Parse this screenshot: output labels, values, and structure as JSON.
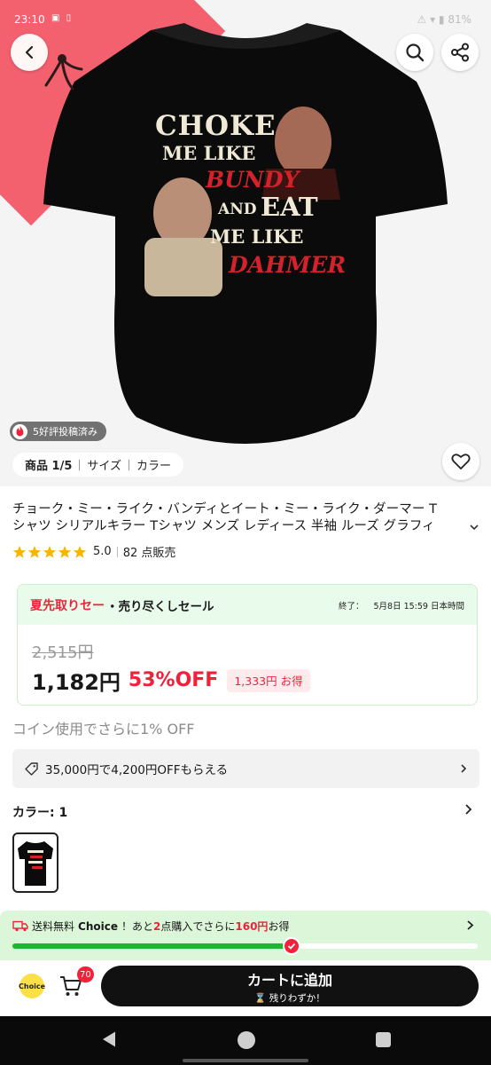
{
  "status": {
    "time": "23:10",
    "icons": "▣ ▯",
    "battery": "81%"
  },
  "gallery": {
    "shirt": {
      "line1": "CHOKE",
      "line2": "ME LIKE",
      "line3": "BUNDY",
      "line4a": "AND",
      "line4b": "EAT",
      "line5": "ME LIKE",
      "line6": "DAHMER"
    },
    "review_badge": "5好評投稿済み",
    "tabs": [
      {
        "label": "商品 1/5"
      },
      {
        "label": "サイズ"
      },
      {
        "label": "カラー"
      }
    ]
  },
  "product": {
    "title_line1": "チョーク・ミー・ライク・バンディとイート・ミー・ライク・ダーマー T",
    "title_line2": "シャツ シリアルキラー Tシャツ メンズ レディース 半袖 ルーズ グラフィ",
    "rating": "5.0",
    "stars": 5,
    "sold": "82 点販売"
  },
  "sale": {
    "label_red": "夏先取りセー",
    "label_dark": "・売り尽くしセール",
    "end_label": "終了：",
    "end_time": "5月8日 15:59 日本時間",
    "old_price": "2,515円",
    "new_price": "1,182円",
    "discount": "53%OFF",
    "save": "1,333円 お得"
  },
  "coin_text": "コイン使用でさらに1% OFF",
  "coupon_text": "35,000円で4,200円OFFもらえる",
  "color_label": "カラー: 1",
  "choice_banner": {
    "prefix": "送料無料",
    "brand": "Choice",
    "text1": "！あと",
    "num1": "2",
    "text2": "点購入でさらに",
    "num2": "160円",
    "text3": "お得",
    "progress": 0.6
  },
  "bottom": {
    "choice_logo": "Choice",
    "cart_count": "70",
    "add_to_cart": "カートに追加",
    "stock_note": "⌛ 残りわずか！"
  },
  "colors": {
    "accent_red": "#f2213a",
    "green": "#1db62f",
    "pink_corner": "#f3606e"
  }
}
